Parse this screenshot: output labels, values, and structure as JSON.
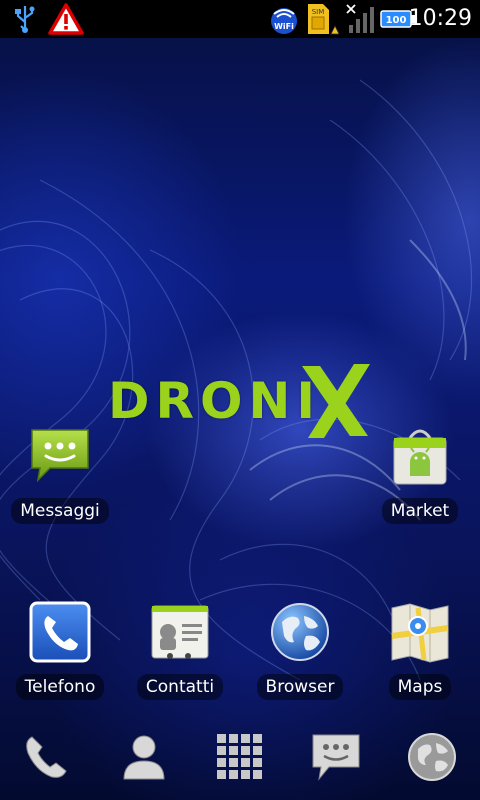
{
  "statusbar": {
    "time": "10:29",
    "battery_level": "100",
    "wifi_label": "WiFi",
    "sim_label": "SIM",
    "icons": [
      "usb-icon",
      "warning-icon",
      "wifi-icon",
      "sim-icon",
      "signal-icon",
      "battery-icon"
    ]
  },
  "wallpaper": {
    "logo_text": "DRONI",
    "logo_color": "#9ad21c"
  },
  "home": {
    "apps": [
      {
        "label": "Messaggi",
        "icon": "messaging-icon"
      },
      {
        "label": "Market",
        "icon": "market-icon"
      },
      {
        "label": "Telefono",
        "icon": "phone-icon"
      },
      {
        "label": "Contatti",
        "icon": "contacts-icon"
      },
      {
        "label": "Browser",
        "icon": "globe-icon"
      },
      {
        "label": "Maps",
        "icon": "maps-icon"
      }
    ]
  },
  "dock": {
    "items": [
      "phone-dock-icon",
      "contacts-dock-icon",
      "app-drawer-icon",
      "messaging-dock-icon",
      "browser-dock-icon"
    ]
  }
}
